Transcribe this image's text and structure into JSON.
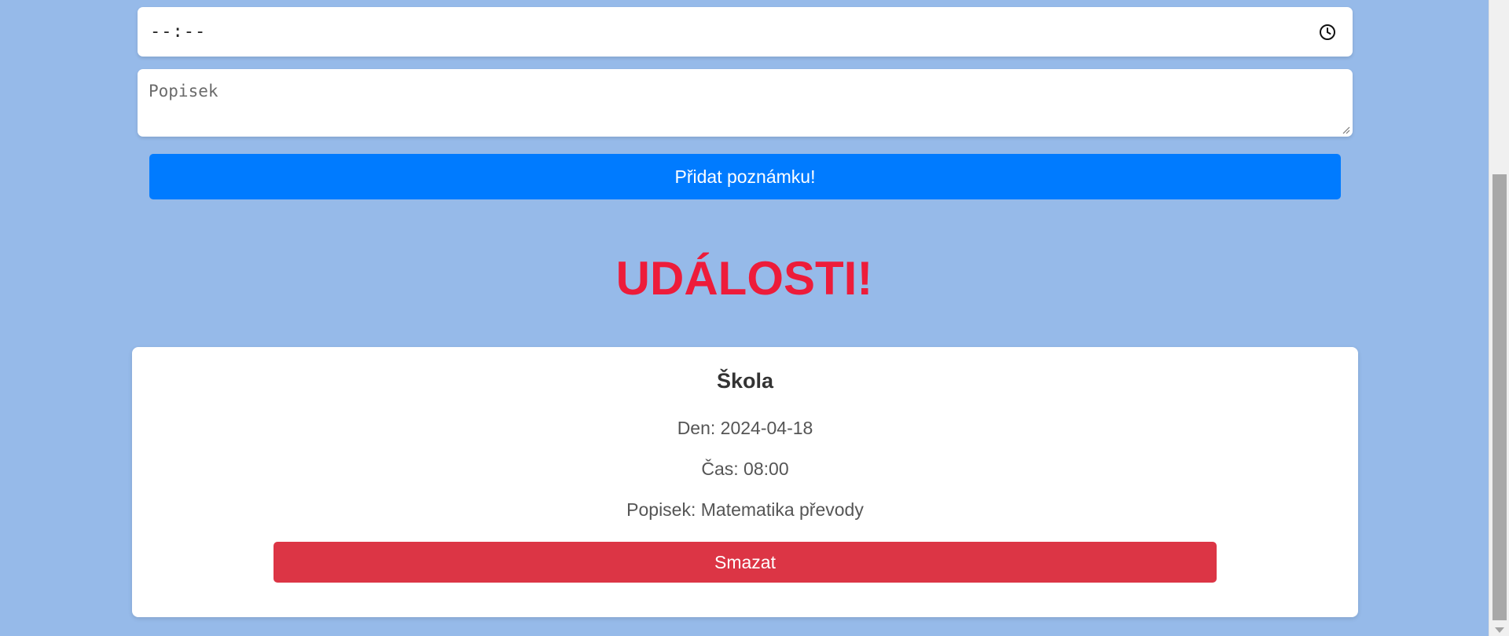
{
  "form": {
    "time_value": "--:--",
    "description_placeholder": "Popisek",
    "submit_label": "Přidat poznámku!"
  },
  "events": {
    "heading": "UDÁLOSTI!",
    "items": [
      {
        "title": "Škola",
        "day": "Den: 2024-04-18",
        "time": "Čas: 08:00",
        "description": "Popisek: Matematika převody",
        "delete_label": "Smazat"
      }
    ]
  },
  "colors": {
    "background": "#96bae9",
    "primary_button": "#007bff",
    "danger_button": "#dc3545",
    "heading": "#ed1c3a"
  },
  "icons": {
    "time_input": "clock-icon",
    "textarea": "resize-handle-icon"
  }
}
